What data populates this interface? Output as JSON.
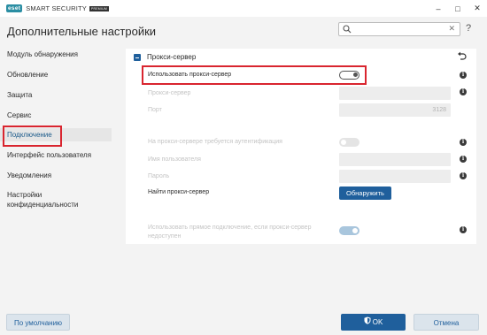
{
  "window": {
    "logo": "eset",
    "product": "SMART SECURITY",
    "edition": "PREMIUM",
    "controls": [
      "–",
      "□",
      "✕"
    ]
  },
  "header": {
    "title": "Дополнительные настройки",
    "search_placeholder": "",
    "help": "?"
  },
  "sidebar": {
    "items": [
      {
        "label": "Модуль обнаружения"
      },
      {
        "label": "Обновление"
      },
      {
        "label": "Защита"
      },
      {
        "label": "Сервис"
      },
      {
        "label": "Подключение",
        "active": true
      },
      {
        "label": "Интерфейс пользователя"
      },
      {
        "label": "Уведомления"
      },
      {
        "label": "Настройки конфиденциальности"
      }
    ]
  },
  "section": {
    "title": "Прокси-сервер",
    "rows": {
      "use_proxy": {
        "label": "Использовать прокси-сервер",
        "state": "off"
      },
      "proxy_server": {
        "label": "Прокси-сервер",
        "value": ""
      },
      "port": {
        "label": "Порт",
        "value": "3128"
      },
      "auth_required": {
        "label": "На прокси-сервере требуется аутентификация",
        "state": "off-disabled"
      },
      "username": {
        "label": "Имя пользователя",
        "value": ""
      },
      "password": {
        "label": "Пароль",
        "value": ""
      },
      "find_proxy": {
        "label": "Найти прокси-сервер",
        "button": "Обнаружить"
      },
      "direct_fallback": {
        "label_line1": "Использовать прямое подключение, если прокси-сервер",
        "label_line2": "недоступен",
        "state": "on-disabled"
      }
    },
    "info_glyph": "i"
  },
  "footer": {
    "default_label": "По умолчанию",
    "ok_label": "OK",
    "cancel_label": "Отмена"
  },
  "colors": {
    "accent": "#1f5f9c",
    "highlight": "#d9252f",
    "brand": "#2b8ea3"
  }
}
